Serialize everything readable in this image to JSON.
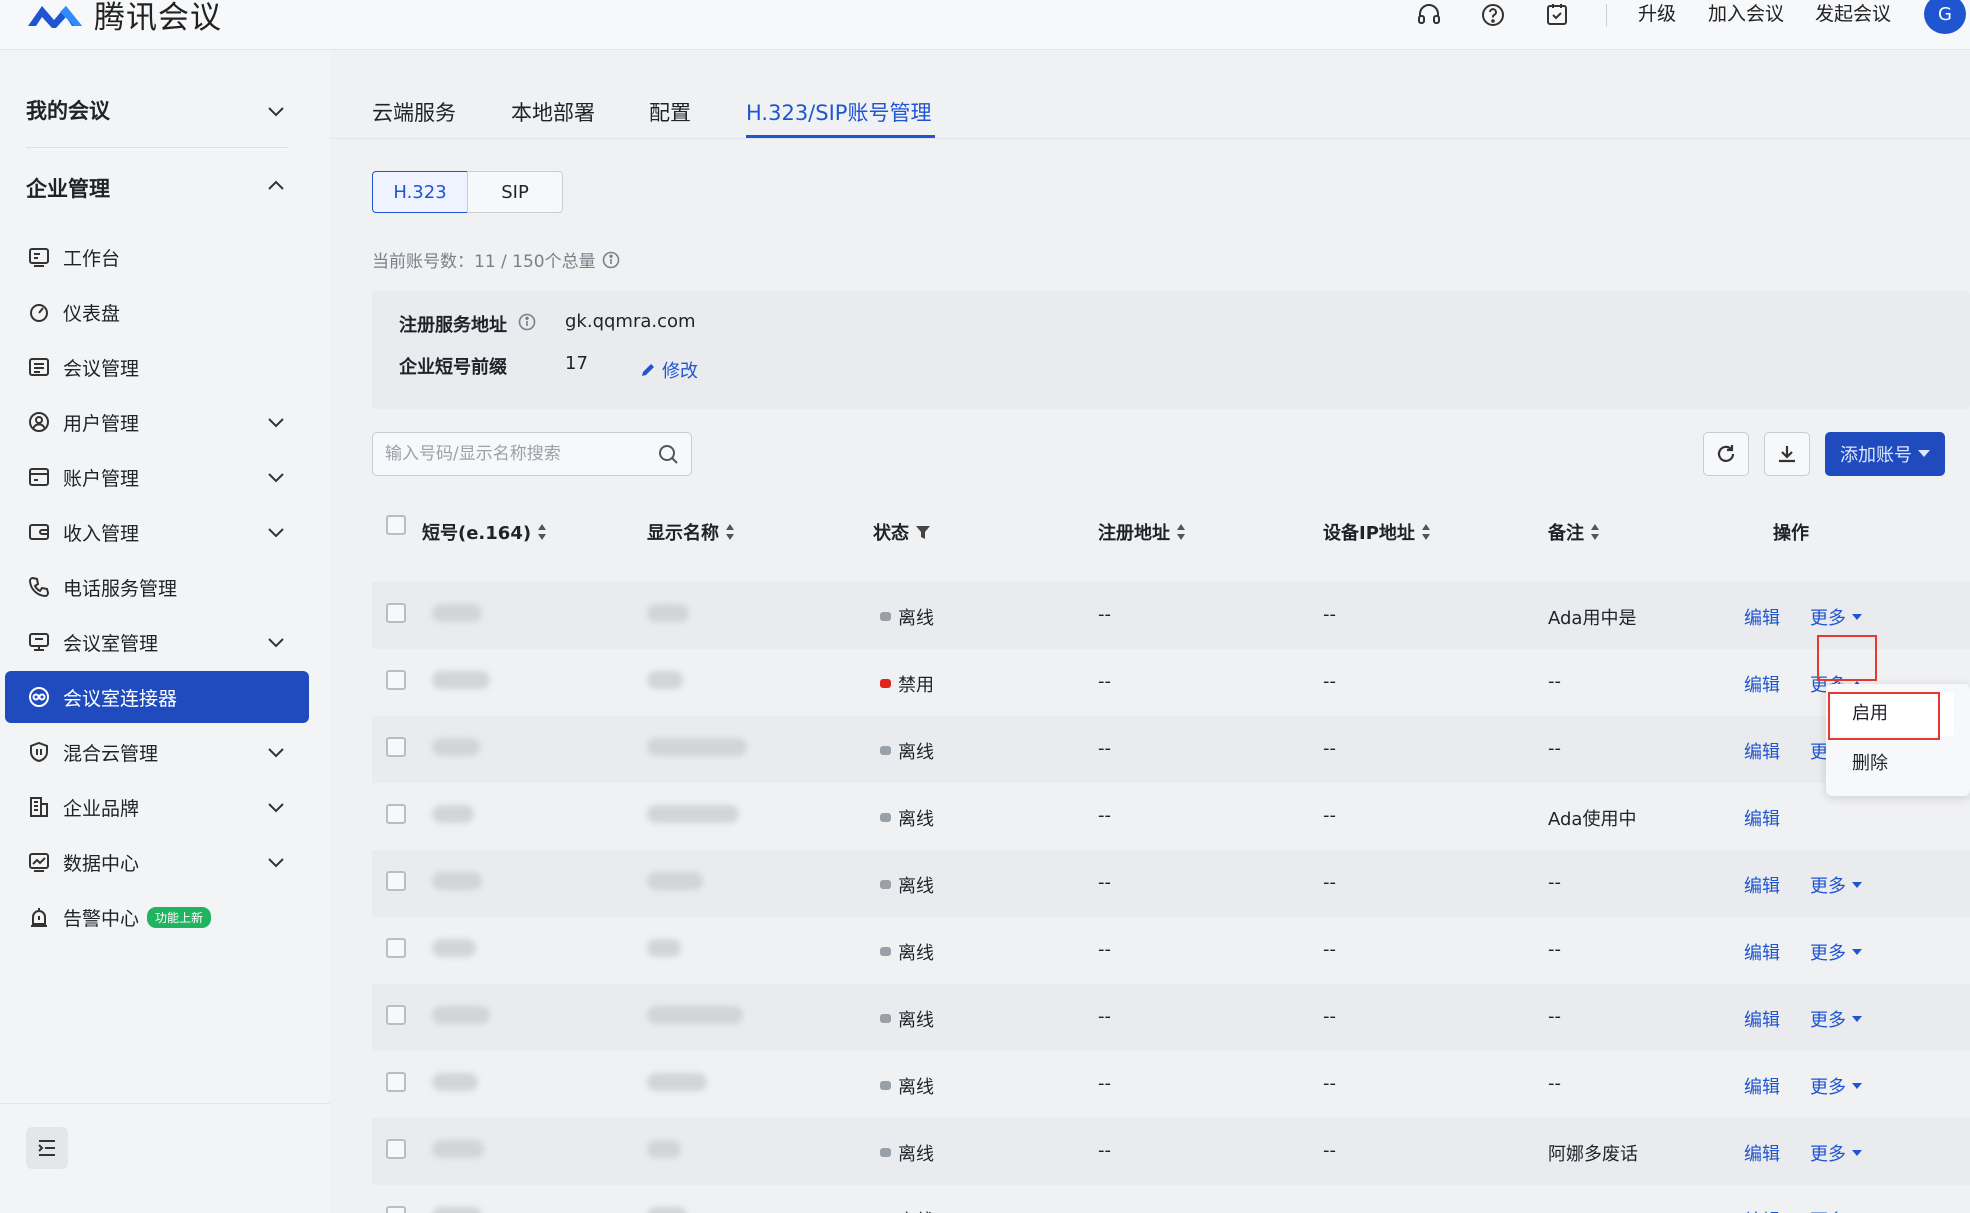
{
  "header": {
    "brand": "腾讯会议",
    "links": [
      "升级",
      "加入会议",
      "发起会议"
    ],
    "avatar": "G",
    "icons": [
      "headset-icon",
      "help-icon",
      "calendar-check-icon"
    ],
    "brand_color": "#1f55d1"
  },
  "sidebar": {
    "my_meetings": "我的会议",
    "enterprise": "企业管理",
    "items": [
      {
        "label": "工作台",
        "icon": "workbench-icon",
        "caret": false
      },
      {
        "label": "仪表盘",
        "icon": "dashboard-icon",
        "caret": false
      },
      {
        "label": "会议管理",
        "icon": "meeting-list-icon",
        "caret": false
      },
      {
        "label": "用户管理",
        "icon": "user-icon",
        "caret": true
      },
      {
        "label": "账户管理",
        "icon": "account-icon",
        "caret": true
      },
      {
        "label": "收入管理",
        "icon": "wallet-icon",
        "caret": true
      },
      {
        "label": "电话服务管理",
        "icon": "phone-icon",
        "caret": false
      },
      {
        "label": "会议室管理",
        "icon": "monitor-icon",
        "caret": true
      },
      {
        "label": "会议室连接器",
        "icon": "connector-icon",
        "caret": false,
        "active": true
      },
      {
        "label": "混合云管理",
        "icon": "shield-icon",
        "caret": true
      },
      {
        "label": "企业品牌",
        "icon": "building-icon",
        "caret": true
      },
      {
        "label": "数据中心",
        "icon": "chart-icon",
        "caret": true
      },
      {
        "label": "告警中心",
        "icon": "alarm-icon",
        "caret": false,
        "badge": "功能上新"
      }
    ]
  },
  "tabs": [
    "云端服务",
    "本地部署",
    "配置",
    "H.323/SIP账号管理"
  ],
  "segments": [
    "H.323",
    "SIP"
  ],
  "count_text": "当前账号数：11 / 150个总量",
  "info": {
    "server_label": "注册服务地址",
    "server_value": "gk.qqmra.com",
    "prefix_label": "企业短号前缀",
    "prefix_value": "17",
    "edit_label": "修改"
  },
  "search": {
    "placeholder": "输入号码/显示名称搜索"
  },
  "add_button": "添加账号",
  "columns": [
    "短号(e.164)",
    "显示名称",
    "状态",
    "注册地址",
    "设备IP地址",
    "备注",
    "操作"
  ],
  "rows": [
    {
      "status": "离线",
      "reg": "--",
      "ip": "--",
      "note": "Ada用中是",
      "more_open": false
    },
    {
      "status": "禁用",
      "reg": "--",
      "ip": "--",
      "note": "--",
      "more_open": true
    },
    {
      "status": "离线",
      "reg": "--",
      "ip": "--",
      "note": "--",
      "more_open": false
    },
    {
      "status": "离线",
      "reg": "--",
      "ip": "--",
      "note": "Ada使用中",
      "more_open": false
    },
    {
      "status": "离线",
      "reg": "--",
      "ip": "--",
      "note": "--",
      "more_open": false
    },
    {
      "status": "离线",
      "reg": "--",
      "ip": "--",
      "note": "--",
      "more_open": false
    },
    {
      "status": "离线",
      "reg": "--",
      "ip": "--",
      "note": "--",
      "more_open": false
    },
    {
      "status": "离线",
      "reg": "--",
      "ip": "--",
      "note": "--",
      "more_open": false
    },
    {
      "status": "离线",
      "reg": "--",
      "ip": "--",
      "note": "阿娜多废话",
      "more_open": false
    },
    {
      "status": "离线",
      "reg": "--",
      "ip": "--",
      "note": "--",
      "more_open": false
    }
  ],
  "op_edit": "编辑",
  "op_more": "更多",
  "dropdown": [
    "启用",
    "删除"
  ]
}
